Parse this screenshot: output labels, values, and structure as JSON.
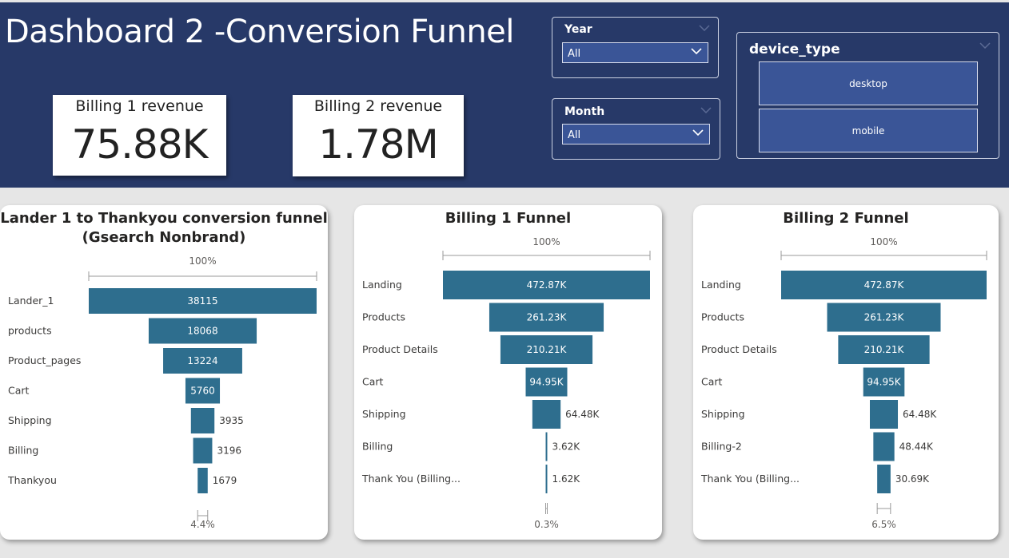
{
  "header": {
    "title": "Dashboard 2 -Conversion Funnel",
    "kpis": [
      {
        "label": "Billing 1 revenue",
        "value": "75.88K"
      },
      {
        "label": "Billing 2 revenue",
        "value": "1.78M"
      }
    ]
  },
  "filters": {
    "year": {
      "title": "Year",
      "value": "All"
    },
    "month": {
      "title": "Month",
      "value": "All"
    },
    "device_type": {
      "title": "device_type",
      "options": [
        "desktop",
        "mobile"
      ]
    }
  },
  "colors": {
    "header": "#273968",
    "bar": "#2e6e8e",
    "tile": "#3a5597"
  },
  "chart_data": [
    {
      "type": "funnel",
      "title": "Lander 1 to Thankyou conversion funnel\n(Gsearch Nonbrand)",
      "top_pct": "100%",
      "bottom_pct": "4.4%",
      "categories": [
        "Lander_1",
        "products",
        "Product_pages",
        "Cart",
        "Shipping",
        "Billing",
        "Thankyou"
      ],
      "values": [
        38115,
        18068,
        13224,
        5760,
        3935,
        3196,
        1679
      ],
      "labels": [
        "38115",
        "18068",
        "13224",
        "5760",
        "3935",
        "3196",
        "1679"
      ]
    },
    {
      "type": "funnel",
      "title": "Billing 1 Funnel",
      "top_pct": "100%",
      "bottom_pct": "0.3%",
      "categories": [
        "Landing",
        "Products",
        "Product Details",
        "Cart",
        "Shipping",
        "Billing",
        "Thank You (Billing..."
      ],
      "values": [
        472870,
        261230,
        210210,
        94950,
        64480,
        3620,
        1620
      ],
      "labels": [
        "472.87K",
        "261.23K",
        "210.21K",
        "94.95K",
        "64.48K",
        "3.62K",
        "1.62K"
      ]
    },
    {
      "type": "funnel",
      "title": "Billing 2 Funnel",
      "top_pct": "100%",
      "bottom_pct": "6.5%",
      "categories": [
        "Landing",
        "Products",
        "Product Details",
        "Cart",
        "Shipping",
        "Billing-2",
        "Thank You (Billing..."
      ],
      "values": [
        472870,
        261230,
        210210,
        94950,
        64480,
        48440,
        30690
      ],
      "labels": [
        "472.87K",
        "261.23K",
        "210.21K",
        "94.95K",
        "64.48K",
        "48.44K",
        "30.69K"
      ]
    }
  ]
}
